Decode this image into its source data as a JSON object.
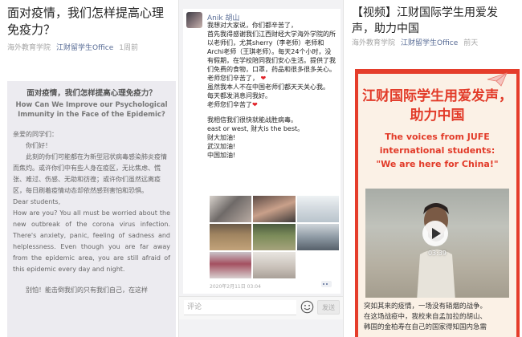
{
  "panel1": {
    "title": "面对疫情，我们怎样提高心理免疫力？",
    "meta_author": "海外教育学院",
    "meta_source": "江财留学生Office",
    "meta_time": "1周前",
    "heading_zh": "面对疫情，我们怎样提高心理免疫力？",
    "heading_en": "How Can We Improve our Psychological Immunity in the Face of the Epidemic?",
    "greeting_zh": "亲爱的同学们：",
    "hello_zh": "你们好！",
    "para_zh": "此刻的你们可能都在为新型冠状病毒感染肺炎疫情而焦灼。或许你们中有些人身在疫区，无比焦虑、慌张、难过、伤感、无助和彷徨；或许你们虽然远离疫区，每日刷着疫情动态却依然感到害怕和恐惧。",
    "greeting_en": "Dear students,",
    "para_en": "How are you? You all must be worried about the new outbreak of the corona virus infection. There's anxiety, panic, feeling of sadness and helplessness. Even though you are far away from the epidemic area, you are still afraid of this epidemic every day and night.",
    "para_zh2": "别怕！能击倒我们的只有我们自己，在这样"
  },
  "panel2": {
    "author": "Anik 胡山",
    "lines_a": [
      "我想对大家说，你们都辛苦了，",
      "首先我得感谢我们江西财经大学海外学院的所以老师们，尤其sherry（李老师）老师和Archi老师（王琪老师）。每天24个小时，没有假期，在学校陪同我们安心生活。提供了我们免费的食物，口罩，药品和很多很多关心。",
      "老师您们辛苦了，",
      "虽然我本人不在中国老师们都天天关心我。",
      "每天都发消息问我好。",
      "老师您们辛苦了"
    ],
    "lines_b": [
      "我相信我们很快就能战胜病毒。",
      "east or west, 财大is the best。",
      "财大加油!",
      "武汉加油!",
      "中国加油!"
    ],
    "heart": "❤",
    "timestamp": "2020年2月11日 03:04",
    "comment_placeholder": "评论",
    "send_label": "发送"
  },
  "panel3": {
    "title": "【视频】江财国际学生用爱发声，助力中国",
    "meta_author": "海外教育学院",
    "meta_source": "江财留学生Office",
    "meta_time": "前天",
    "poster_zh": "江财国际学生用爱发声，助力中国",
    "poster_en_1": "The voices from JUFE",
    "poster_en_2": "international students:",
    "poster_en_3": "\"We are here for China!\"",
    "video_duration": "03:39",
    "foot_1": "突如其来的疫情，一场没有硝烟的战争。",
    "foot_2": "在这场战疫中，我校来自孟加拉的胡山、",
    "foot_3": "韩国的金柏寿在自己的国家得知国内急需"
  },
  "colors": {
    "accent_red": "#e23b29",
    "link_blue": "#576b95",
    "meta_gray": "#a6a6a6",
    "poster_bg": "#fbf1e6",
    "article_box": "#ecebf0"
  },
  "icons": [
    "emoji-icon",
    "play-icon",
    "paper-plane-icon",
    "more-icon"
  ]
}
